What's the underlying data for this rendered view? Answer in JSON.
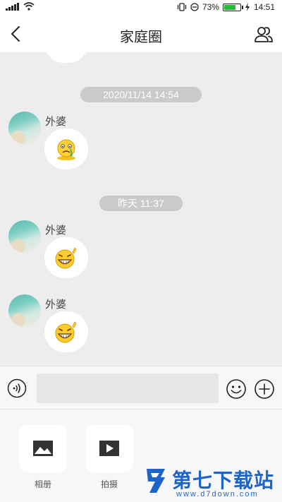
{
  "status_bar": {
    "battery_percent": "73%",
    "battery_level": 0.73,
    "time": "14:51",
    "icons": [
      "signal-bars-icon",
      "wifi-icon",
      "vibrate-icon",
      "dnd-icon",
      "battery-icon",
      "charging-icon"
    ]
  },
  "header": {
    "title": "家庭圈",
    "back_icon": "chevron-left-icon",
    "group_icon": "group-members-icon"
  },
  "chat": {
    "messages": [
      {
        "timestamp": "2020/11/14 14:54",
        "sender": "外婆",
        "emoji": "crying-emoji"
      },
      {
        "timestamp": "昨天 11:37",
        "sender": "外婆",
        "emoji": "grinning-emoji"
      },
      {
        "timestamp": "",
        "sender": "外婆",
        "emoji": "grinning-emoji"
      }
    ]
  },
  "input_bar": {
    "placeholder": "",
    "voice_icon": "voice-icon",
    "emoji_icon": "emoji-icon",
    "plus_icon": "plus-icon"
  },
  "panel": {
    "tools": [
      {
        "label": "相册",
        "icon": "image-icon"
      },
      {
        "label": "拍摄",
        "icon": "video-icon"
      }
    ]
  },
  "watermark": {
    "text": "第七下载站",
    "url": "www.d7down.com"
  },
  "colors": {
    "chat_bg": "#ededed",
    "time_pill": "#cacaca",
    "battery_fill": "#1fbf2f",
    "watermark": "#1c64c8"
  }
}
